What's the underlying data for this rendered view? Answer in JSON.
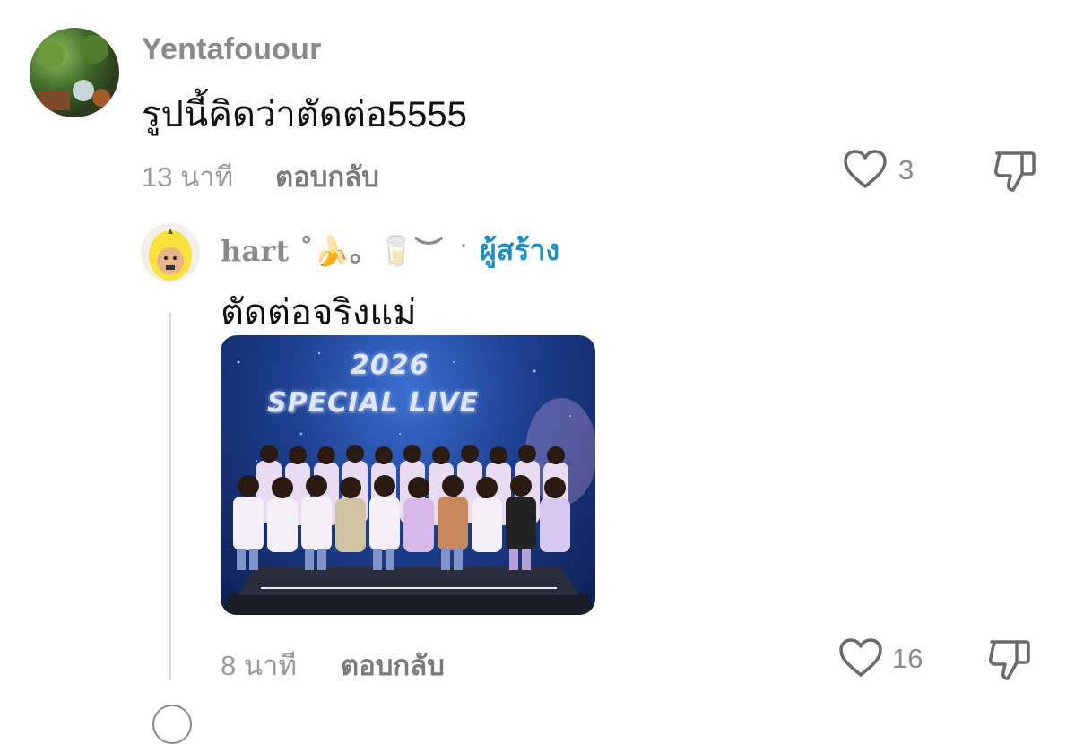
{
  "comments": [
    {
      "username": "Yentafouour",
      "text": "รูปนี้คิดว่าตัดต่อ5555",
      "time": "13 นาที",
      "reply_label": "ตอบกลับ",
      "likes": "3",
      "avatar_icon": "garden-photo-avatar"
    }
  ],
  "reply": {
    "username": "hart ˚🍌。🥛︶",
    "dot": "·",
    "creator_badge": "ผู้สร้าง",
    "text": "ตัดต่อจริงแม่",
    "photo": {
      "title_line1": "2026",
      "title_line2": "SPECIAL LIVE"
    },
    "time": "8 นาที",
    "reply_label": "ตอบกลับ",
    "likes": "16",
    "avatar_icon": "banana-costume-avatar"
  },
  "colors": {
    "username": "#8a8a8a",
    "creator": "#1e8fbf",
    "meta": "#9a9a9a"
  }
}
